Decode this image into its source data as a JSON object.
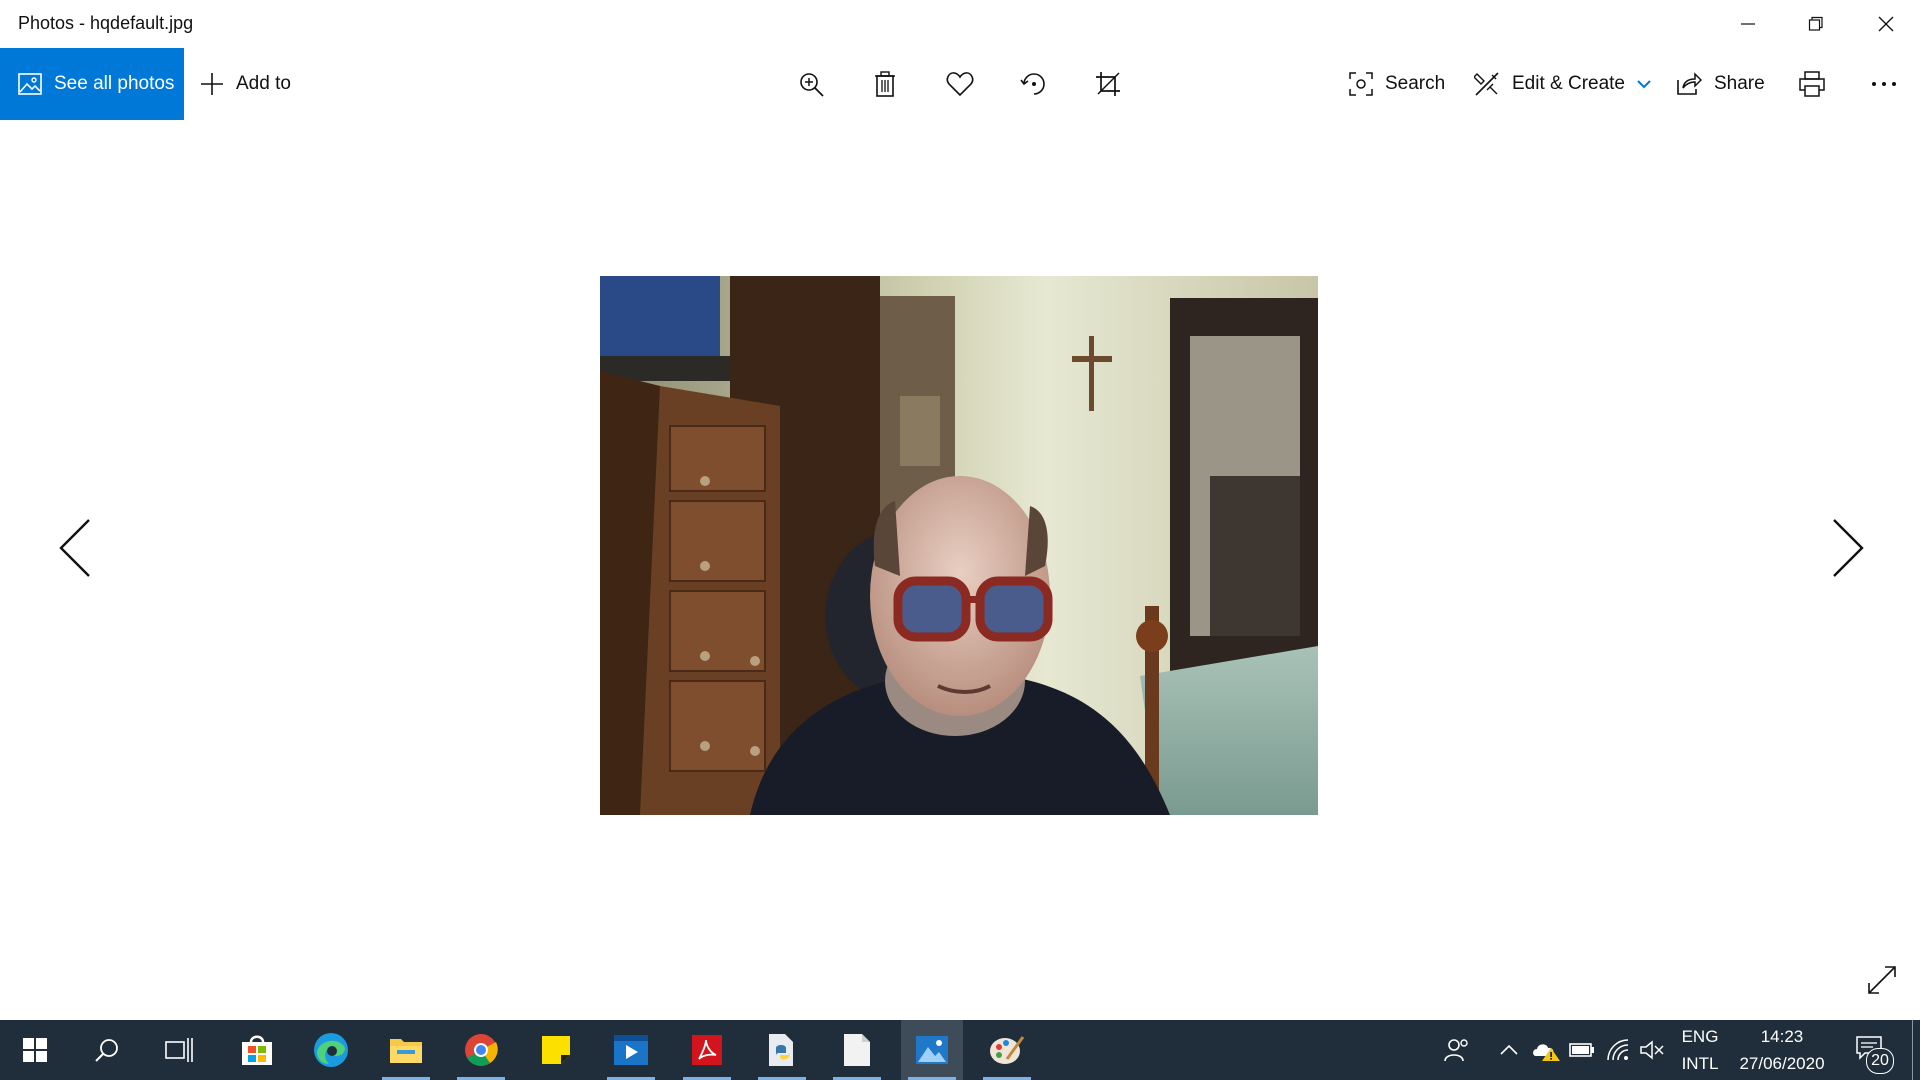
{
  "window": {
    "title": "Photos - hqdefault.jpg"
  },
  "window_controls": [
    "minimize-icon",
    "restore-icon",
    "close-icon"
  ],
  "toolbar": {
    "see_all_label": "See all photos",
    "add_to_label": "Add to",
    "center_icons": [
      "zoom-in-icon",
      "delete-icon",
      "favorite-icon",
      "rotate-icon",
      "crop-icon"
    ],
    "search_label": "Search",
    "edit_create_label": "Edit & Create",
    "share_label": "Share",
    "print_icon": "print-icon",
    "more_icon": "more-icon"
  },
  "viewer": {
    "image_content": "webcam-photo-man-with-glasses-in-bedroom",
    "prev_icon": "chevron-left-icon",
    "next_icon": "chevron-right-icon",
    "fullscreen_icon": "expand-icon"
  },
  "taskbar": {
    "apps": [
      {
        "name": "start-icon"
      },
      {
        "name": "search-icon"
      },
      {
        "name": "task-view-icon"
      },
      {
        "name": "store-icon"
      },
      {
        "name": "edge-icon"
      },
      {
        "name": "file-explorer-icon"
      },
      {
        "name": "chrome-icon"
      },
      {
        "name": "sticky-notes-icon"
      },
      {
        "name": "video-app-icon"
      },
      {
        "name": "acrobat-icon"
      },
      {
        "name": "python-icon"
      },
      {
        "name": "notepad-icon"
      },
      {
        "name": "photos-icon"
      },
      {
        "name": "paint-icon"
      }
    ],
    "tray": {
      "lang_top": "ENG",
      "lang_bottom": "INTL",
      "time": "14:23",
      "date": "27/06/2020",
      "notification_count": "20"
    }
  },
  "colors": {
    "accent": "#0078d7",
    "taskbar": "#1f2e3a",
    "taskbar_indicator": "#7eb2e6"
  }
}
